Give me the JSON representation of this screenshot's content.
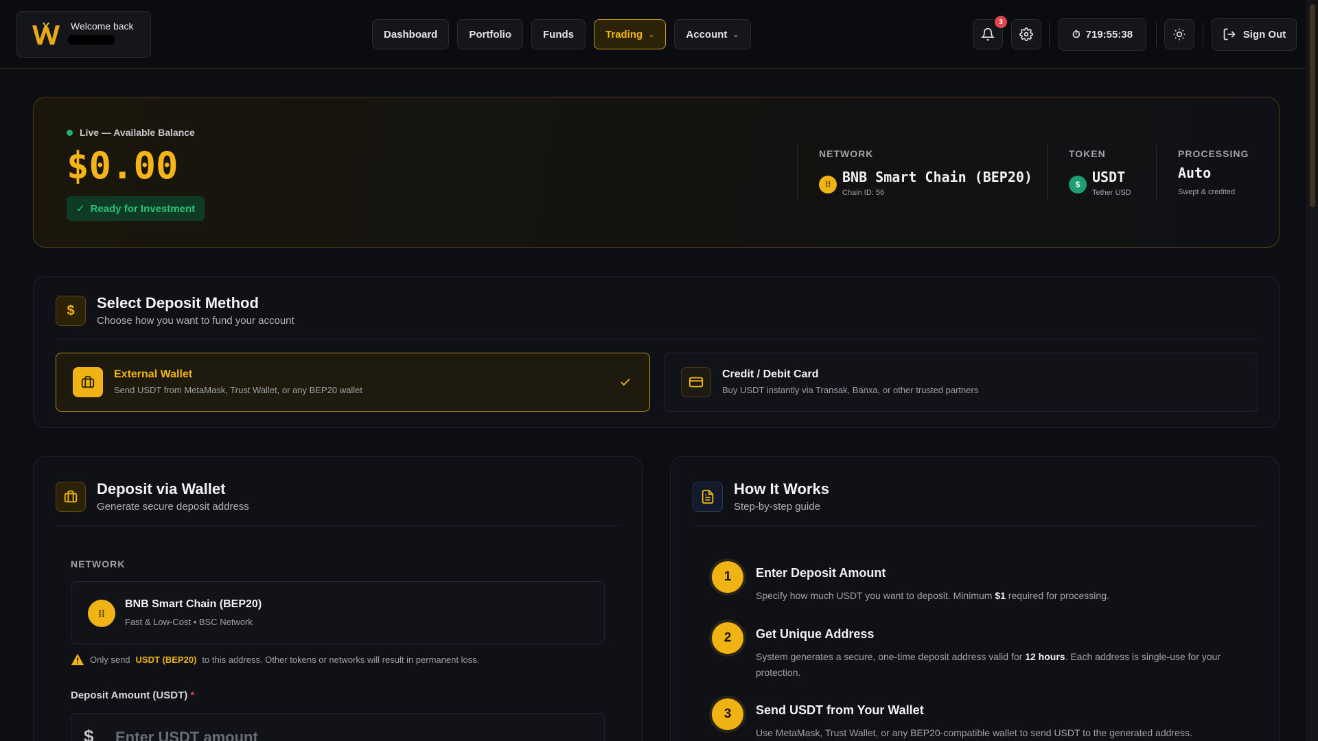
{
  "header": {
    "welcome": "Welcome back",
    "nav": [
      {
        "label": "Dashboard",
        "active": false,
        "dropdown": false
      },
      {
        "label": "Portfolio",
        "active": false,
        "dropdown": false
      },
      {
        "label": "Funds",
        "active": false,
        "dropdown": false
      },
      {
        "label": "Trading",
        "active": true,
        "dropdown": true
      },
      {
        "label": "Account",
        "active": false,
        "dropdown": true
      }
    ],
    "notification_count": "3",
    "timer": "719:55:38",
    "sign_out": "Sign Out"
  },
  "balance": {
    "live_label": "Live — Available Balance",
    "amount": "$0.00",
    "ready": "Ready for Investment",
    "network_label": "NETWORK",
    "network_value": "BNB Smart Chain (BEP20)",
    "network_sub": "Chain ID: 56",
    "token_label": "TOKEN",
    "token_value": "USDT",
    "token_sub": "Tether USD",
    "processing_label": "PROCESSING",
    "processing_value": "Auto",
    "processing_sub": "Swept & credited"
  },
  "deposit_method": {
    "title": "Select Deposit Method",
    "subtitle": "Choose how you want to fund your account",
    "options": [
      {
        "title": "External Wallet",
        "subtitle": "Send USDT from MetaMask, Trust Wallet, or any BEP20 wallet",
        "selected": true
      },
      {
        "title": "Credit / Debit Card",
        "subtitle": "Buy USDT instantly via Transak, Banxa, or other trusted partners",
        "selected": false
      }
    ]
  },
  "wallet": {
    "title": "Deposit via Wallet",
    "subtitle": "Generate secure deposit address",
    "network_label": "NETWORK",
    "network_title": "BNB Smart Chain (BEP20)",
    "network_sub": "Fast & Low-Cost • BSC Network",
    "warning_pre": "Only send",
    "warning_token": "USDT (BEP20)",
    "warning_post": "to this address. Other tokens or networks will result in permanent loss.",
    "amount_label": "Deposit Amount (USDT)",
    "amount_required": "*",
    "amount_currency": "$",
    "amount_placeholder": "Enter USDT amount"
  },
  "how": {
    "title": "How It Works",
    "subtitle": "Step-by-step guide",
    "steps": [
      {
        "num": "1",
        "title": "Enter Deposit Amount",
        "text_pre": "Specify how much USDT you want to deposit. Minimum",
        "text_bold": "$1",
        "text_post": "required for processing."
      },
      {
        "num": "2",
        "title": "Get Unique Address",
        "text_pre": "System generates a secure, one-time deposit address valid for",
        "text_bold": "12 hours",
        "text_post": ". Each address is single-use for your protection."
      },
      {
        "num": "3",
        "title": "Send USDT from Your Wallet",
        "text_pre": "Use MetaMask, Trust Wallet, or any BEP20-compatible wallet to send USDT to the generated address.",
        "text_bold": "",
        "text_post": ""
      }
    ]
  },
  "colors": {
    "accent": "#f1b515",
    "success": "#29c276",
    "danger": "#e0454d",
    "background": "#0c0e13"
  }
}
